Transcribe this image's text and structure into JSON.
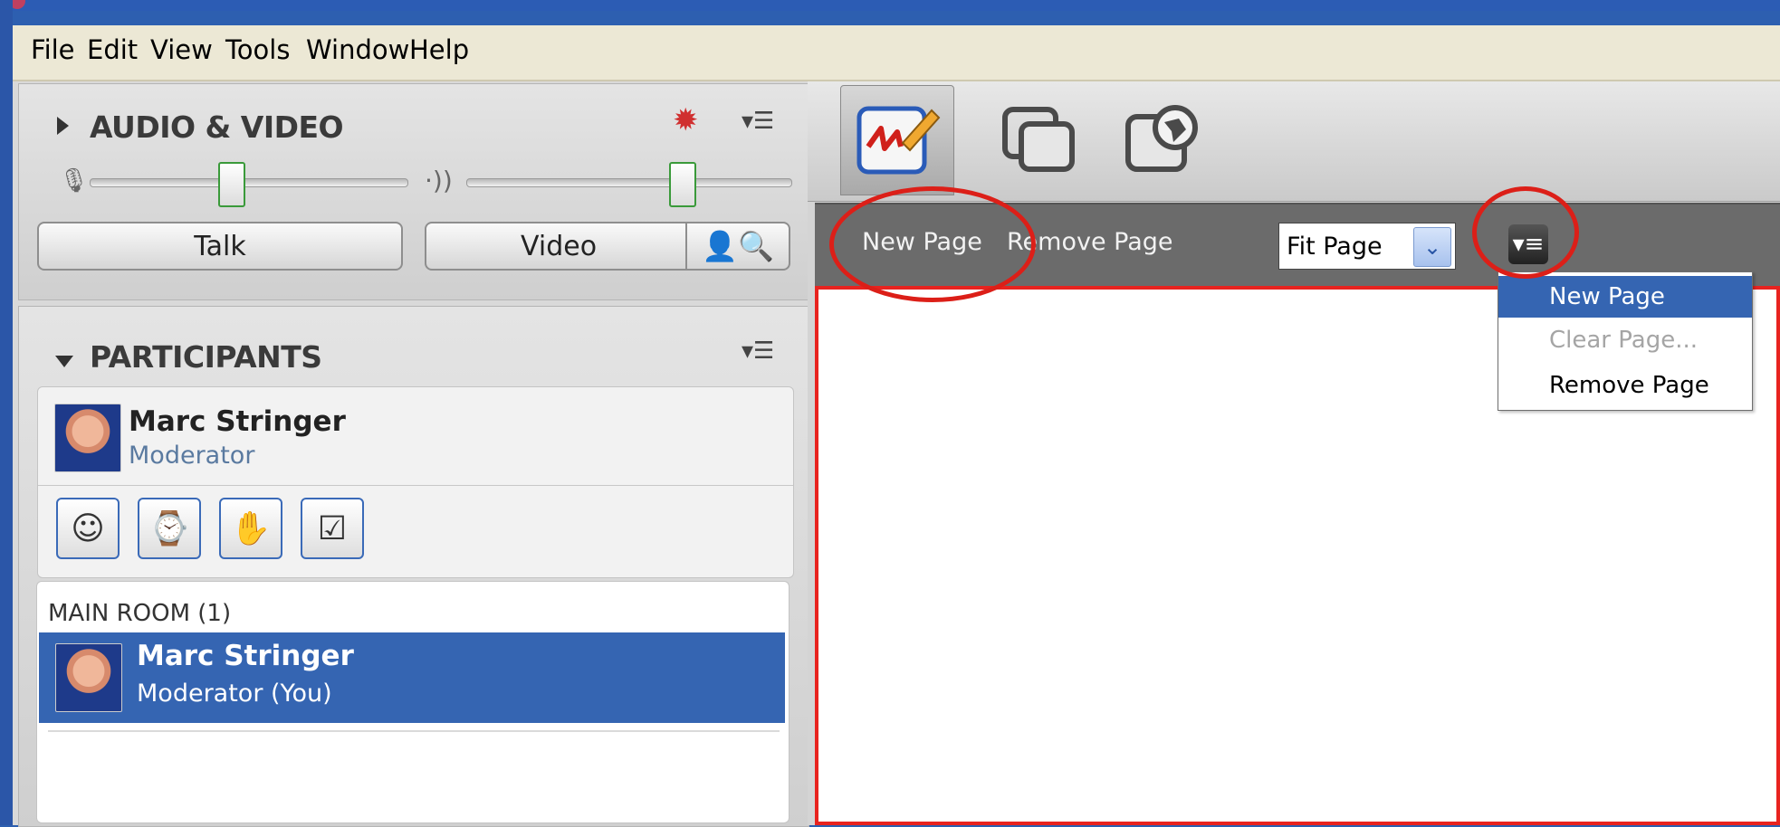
{
  "menu": [
    "File",
    "Edit",
    "View",
    "Tools",
    "Window",
    "Help"
  ],
  "audio_video": {
    "title": "AUDIO & VIDEO",
    "talk_label": "Talk",
    "video_label": "Video"
  },
  "participants": {
    "title": "PARTICIPANTS",
    "me": {
      "name": "Marc Stringer",
      "role": "Moderator"
    },
    "room_label": "MAIN ROOM (1)",
    "list": [
      {
        "name": "Marc Stringer",
        "role": "Moderator (You)"
      }
    ]
  },
  "whiteboard": {
    "new_page": "New Page",
    "remove_page": "Remove Page",
    "zoom_select": "Fit Page"
  },
  "options_menu": {
    "items": [
      {
        "label": "New Page",
        "state": "selected"
      },
      {
        "label": "Clear Page...",
        "state": "disabled"
      },
      {
        "label": "Remove Page",
        "state": "normal"
      }
    ]
  },
  "colors": {
    "highlight": "#3565b2",
    "annotation_red": "#dc1f18",
    "toolbar": "#6b6b6b"
  }
}
